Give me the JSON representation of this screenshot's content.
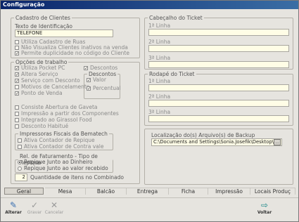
{
  "window": {
    "title": "Configuração"
  },
  "cadastro": {
    "legend": "Cadastro de Clientes",
    "texto_label": "Texto de Identificação",
    "texto_value": "TELEFONE",
    "options": [
      {
        "label": "Utiliza Cadastro de Ruas",
        "checked": false
      },
      {
        "label": "Não Visualiza Clientes inativos na venda",
        "checked": false
      },
      {
        "label": "Permite duplicidade no código do Cliente",
        "checked": true
      }
    ]
  },
  "opcoes": {
    "legend": "Opções de trabalho",
    "items": [
      {
        "label": "Utiliza Pocket PC",
        "checked": true
      },
      {
        "label": "Altera Serviço",
        "checked": true
      },
      {
        "label": "Serviço com Desconto",
        "checked": true
      },
      {
        "label": "Motivos de Cancelamento",
        "checked": false
      },
      {
        "label": "Ponto de Venda",
        "checked": true
      }
    ],
    "descontos_check": {
      "label": "Descontos",
      "checked": true
    },
    "descontos_group": {
      "legend": "Descontos",
      "items": [
        {
          "label": "Valor",
          "checked": true
        },
        {
          "label": "Percentual",
          "checked": true
        }
      ]
    },
    "more": [
      {
        "label": "Consiste Abertura de Gaveta",
        "checked": false
      },
      {
        "label": "Impressão a partir dos Componentes",
        "checked": false
      },
      {
        "label": "Integrado ao Girassol Food",
        "checked": false
      },
      {
        "label": "Desconto Habitué",
        "checked": false
      }
    ],
    "impressoras": {
      "legend": "Impressoras Fiscais da Bematech",
      "items": [
        {
          "label": "Ativa Contador de Repique",
          "checked": false
        },
        {
          "label": "Ativa Contador de Contra vale",
          "checked": false
        }
      ]
    },
    "faturamento": {
      "legend": "Rel. de Faturamento - Tipo de Repique",
      "options": [
        {
          "label": "Repique Junto ao Dinheiro",
          "selected": true
        },
        {
          "label": "Repique Junto ao valor recebido",
          "selected": false
        }
      ]
    },
    "quantidade": {
      "value": "2",
      "label": "Quantidade de itens no Combinado"
    }
  },
  "cabecalho": {
    "legend": "Cabeçalho do Ticket",
    "lines": [
      {
        "label": "1ª Linha",
        "value": ""
      },
      {
        "label": "2ª Linha",
        "value": ""
      },
      {
        "label": "3ª Linha",
        "value": ""
      }
    ]
  },
  "rodape": {
    "legend": "Rodapé do Ticket",
    "lines": [
      {
        "label": "1ª Linha",
        "value": ""
      },
      {
        "label": "2ª Linha",
        "value": ""
      },
      {
        "label": "3ª Linha",
        "value": ""
      }
    ]
  },
  "backup": {
    "label": "Localização do(s) Arquivo(s) de Backup",
    "value": "C:\\Documents and Settings\\Sonia.Josefik\\Desktop\\",
    "browse_label": "..."
  },
  "tabs": [
    {
      "label": "Geral",
      "active": true
    },
    {
      "label": "Mesa",
      "active": false
    },
    {
      "label": "Balcão",
      "active": false
    },
    {
      "label": "Entrega",
      "active": false
    },
    {
      "label": "Ficha",
      "active": false
    },
    {
      "label": "Impressão",
      "active": false
    },
    {
      "label": "Locais Produç",
      "active": false
    }
  ],
  "toolbar": {
    "alterar": "Alterar",
    "gravar": "Gravar",
    "cancelar": "Cancelar",
    "voltar": "Voltar"
  },
  "icons": {
    "alterar": "edit-icon",
    "gravar": "check-icon",
    "cancelar": "cancel-icon",
    "voltar": "exit-door-icon"
  }
}
